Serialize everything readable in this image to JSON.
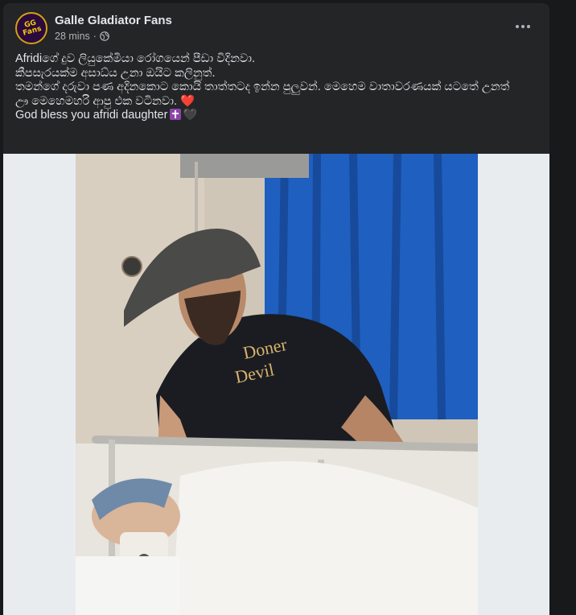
{
  "post": {
    "page_name": "Galle Gladiator Fans",
    "avatar_text": "GG Fans",
    "timestamp": "28 mins",
    "separator": "·",
    "audience_icon": "globe-icon",
    "more_icon": "more-options-icon",
    "text_lines": [
      "Afridiගේ දුව ලියුකේමියා රෝගයෙන් පීඩා විදිනවා.",
      "කීපසැරයක්ම අසාධ්ය උනා ඔයිට කලිනුත්.",
      "තමන්ගේ දරුවා පණ අදිනකොට කොයි තාත්තටද ඉන්න පුලුවන්. මෙහෙම වාතාවරණයක් යටතේ උනත්",
      "ඌ මෙහෙමහරි ආපු එක වටිනවා.",
      "God bless you afridi daughter"
    ],
    "emoji": {
      "line4": "❤️",
      "line5_cross": "latin-cross-icon",
      "line5_heart": "🖤"
    },
    "photo_alt": "Father in cap and black t-shirt leaning over hospital bed where child sleeps under white blanket"
  },
  "colors": {
    "background": "#18191a",
    "card": "#242526",
    "text": "#e4e6eb",
    "secondary_text": "#b0b3b8",
    "brand_purple": "#2b0a3d",
    "brand_gold": "#f6c90e"
  }
}
